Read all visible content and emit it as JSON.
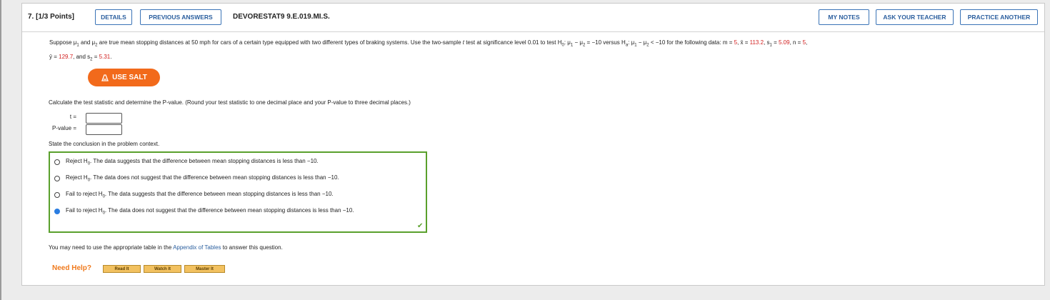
{
  "question": {
    "number": "7. [1/3 Points]",
    "details_label": "DETAILS",
    "previous_answers_label": "PREVIOUS ANSWERS",
    "code": "DEVORESTAT9 9.E.019.MI.S.",
    "my_notes_label": "MY NOTES",
    "ask_teacher_label": "ASK YOUR TEACHER",
    "practice_another_label": "PRACTICE ANOTHER"
  },
  "problem": {
    "line1_a": "Suppose μ",
    "line1_b": " and μ",
    "line1_c": " are true mean stopping distances at 50 mph for cars of a certain type equipped with two different types of braking systems. Use the two-sample ",
    "line1_t": "t",
    "line1_d": " test at significance level 0.01 to test H",
    "line1_e": ": μ",
    "line1_f": " − μ",
    "line1_g": " = −10 versus H",
    "line1_h": ": μ",
    "line1_i": " − μ",
    "line1_j": " < −10 for the following data: m = ",
    "m_value": "5",
    "xbar_label": ", x̄ = ",
    "xbar_value": "113.2",
    "s1_label": ", s",
    "s1_eq": " = ",
    "s1_value": "5.09",
    "n_label": ", n = ",
    "n_value": "5",
    "ybar_label": "ȳ = ",
    "ybar_value": "129.7",
    "s2_label": ", and s",
    "s2_eq": " = ",
    "s2_value": "5.31",
    "period": ".",
    "sub1": "1",
    "sub2": "2",
    "sub0": "0",
    "suba": "a"
  },
  "salt_label": "USE SALT",
  "instruction": "Calculate the test statistic and determine the P-value. (Round your test statistic to one decimal place and your P-value to three decimal places.)",
  "answers": {
    "t_label": "t =",
    "t_value": "",
    "p_label": "P-value =",
    "p_value": ""
  },
  "conclusion_prompt": "State the conclusion in the problem context.",
  "options": [
    {
      "prefix": "Reject H",
      "sub": "0",
      "text": ". The data suggests that the difference between mean stopping distances is less than −10.",
      "selected": false
    },
    {
      "prefix": "Reject H",
      "sub": "0",
      "text": ". The data does not suggest that the difference between mean stopping distances is less than −10.",
      "selected": false
    },
    {
      "prefix": "Fail to reject H",
      "sub": "0",
      "text": ". The data suggests that the difference between mean stopping distances is less than −10.",
      "selected": false
    },
    {
      "prefix": "Fail to reject H",
      "sub": "0",
      "text": ". The data does not suggest that the difference between mean stopping distances is less than −10.",
      "selected": true
    }
  ],
  "appendix": {
    "before": "You may need to use the appropriate table in the ",
    "link": "Appendix of Tables",
    "after": " to answer this question."
  },
  "help": {
    "label": "Need Help?",
    "read_it": "Read It",
    "watch_it": "Watch It",
    "master_it": "Master It"
  },
  "colors": {
    "accent": "#3b74b7",
    "salt": "#f26a1b",
    "correct": "#5aa02c",
    "value_red": "#d21f1f",
    "selected_radio": "#2a7de1"
  }
}
